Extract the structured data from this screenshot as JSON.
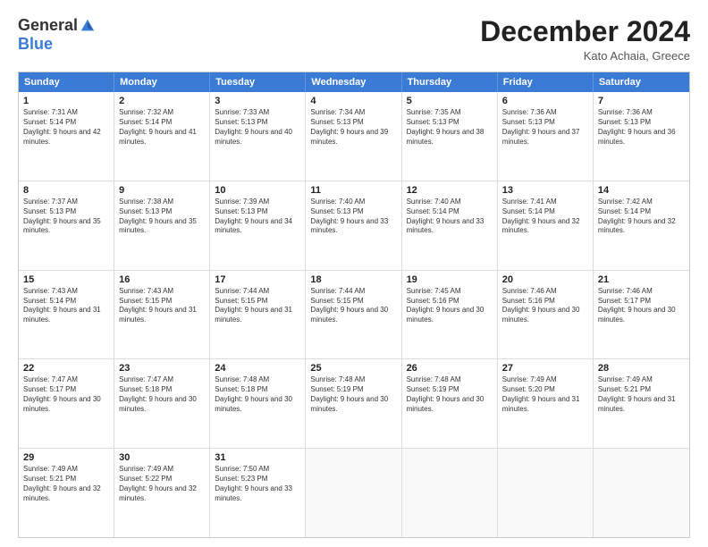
{
  "logo": {
    "general": "General",
    "blue": "Blue"
  },
  "header": {
    "month": "December 2024",
    "location": "Kato Achaia, Greece"
  },
  "weekdays": [
    "Sunday",
    "Monday",
    "Tuesday",
    "Wednesday",
    "Thursday",
    "Friday",
    "Saturday"
  ],
  "rows": [
    [
      {
        "day": "1",
        "sunrise": "Sunrise: 7:31 AM",
        "sunset": "Sunset: 5:14 PM",
        "daylight": "Daylight: 9 hours and 42 minutes."
      },
      {
        "day": "2",
        "sunrise": "Sunrise: 7:32 AM",
        "sunset": "Sunset: 5:14 PM",
        "daylight": "Daylight: 9 hours and 41 minutes."
      },
      {
        "day": "3",
        "sunrise": "Sunrise: 7:33 AM",
        "sunset": "Sunset: 5:13 PM",
        "daylight": "Daylight: 9 hours and 40 minutes."
      },
      {
        "day": "4",
        "sunrise": "Sunrise: 7:34 AM",
        "sunset": "Sunset: 5:13 PM",
        "daylight": "Daylight: 9 hours and 39 minutes."
      },
      {
        "day": "5",
        "sunrise": "Sunrise: 7:35 AM",
        "sunset": "Sunset: 5:13 PM",
        "daylight": "Daylight: 9 hours and 38 minutes."
      },
      {
        "day": "6",
        "sunrise": "Sunrise: 7:36 AM",
        "sunset": "Sunset: 5:13 PM",
        "daylight": "Daylight: 9 hours and 37 minutes."
      },
      {
        "day": "7",
        "sunrise": "Sunrise: 7:36 AM",
        "sunset": "Sunset: 5:13 PM",
        "daylight": "Daylight: 9 hours and 36 minutes."
      }
    ],
    [
      {
        "day": "8",
        "sunrise": "Sunrise: 7:37 AM",
        "sunset": "Sunset: 5:13 PM",
        "daylight": "Daylight: 9 hours and 35 minutes."
      },
      {
        "day": "9",
        "sunrise": "Sunrise: 7:38 AM",
        "sunset": "Sunset: 5:13 PM",
        "daylight": "Daylight: 9 hours and 35 minutes."
      },
      {
        "day": "10",
        "sunrise": "Sunrise: 7:39 AM",
        "sunset": "Sunset: 5:13 PM",
        "daylight": "Daylight: 9 hours and 34 minutes."
      },
      {
        "day": "11",
        "sunrise": "Sunrise: 7:40 AM",
        "sunset": "Sunset: 5:13 PM",
        "daylight": "Daylight: 9 hours and 33 minutes."
      },
      {
        "day": "12",
        "sunrise": "Sunrise: 7:40 AM",
        "sunset": "Sunset: 5:14 PM",
        "daylight": "Daylight: 9 hours and 33 minutes."
      },
      {
        "day": "13",
        "sunrise": "Sunrise: 7:41 AM",
        "sunset": "Sunset: 5:14 PM",
        "daylight": "Daylight: 9 hours and 32 minutes."
      },
      {
        "day": "14",
        "sunrise": "Sunrise: 7:42 AM",
        "sunset": "Sunset: 5:14 PM",
        "daylight": "Daylight: 9 hours and 32 minutes."
      }
    ],
    [
      {
        "day": "15",
        "sunrise": "Sunrise: 7:43 AM",
        "sunset": "Sunset: 5:14 PM",
        "daylight": "Daylight: 9 hours and 31 minutes."
      },
      {
        "day": "16",
        "sunrise": "Sunrise: 7:43 AM",
        "sunset": "Sunset: 5:15 PM",
        "daylight": "Daylight: 9 hours and 31 minutes."
      },
      {
        "day": "17",
        "sunrise": "Sunrise: 7:44 AM",
        "sunset": "Sunset: 5:15 PM",
        "daylight": "Daylight: 9 hours and 31 minutes."
      },
      {
        "day": "18",
        "sunrise": "Sunrise: 7:44 AM",
        "sunset": "Sunset: 5:15 PM",
        "daylight": "Daylight: 9 hours and 30 minutes."
      },
      {
        "day": "19",
        "sunrise": "Sunrise: 7:45 AM",
        "sunset": "Sunset: 5:16 PM",
        "daylight": "Daylight: 9 hours and 30 minutes."
      },
      {
        "day": "20",
        "sunrise": "Sunrise: 7:46 AM",
        "sunset": "Sunset: 5:16 PM",
        "daylight": "Daylight: 9 hours and 30 minutes."
      },
      {
        "day": "21",
        "sunrise": "Sunrise: 7:46 AM",
        "sunset": "Sunset: 5:17 PM",
        "daylight": "Daylight: 9 hours and 30 minutes."
      }
    ],
    [
      {
        "day": "22",
        "sunrise": "Sunrise: 7:47 AM",
        "sunset": "Sunset: 5:17 PM",
        "daylight": "Daylight: 9 hours and 30 minutes."
      },
      {
        "day": "23",
        "sunrise": "Sunrise: 7:47 AM",
        "sunset": "Sunset: 5:18 PM",
        "daylight": "Daylight: 9 hours and 30 minutes."
      },
      {
        "day": "24",
        "sunrise": "Sunrise: 7:48 AM",
        "sunset": "Sunset: 5:18 PM",
        "daylight": "Daylight: 9 hours and 30 minutes."
      },
      {
        "day": "25",
        "sunrise": "Sunrise: 7:48 AM",
        "sunset": "Sunset: 5:19 PM",
        "daylight": "Daylight: 9 hours and 30 minutes."
      },
      {
        "day": "26",
        "sunrise": "Sunrise: 7:48 AM",
        "sunset": "Sunset: 5:19 PM",
        "daylight": "Daylight: 9 hours and 30 minutes."
      },
      {
        "day": "27",
        "sunrise": "Sunrise: 7:49 AM",
        "sunset": "Sunset: 5:20 PM",
        "daylight": "Daylight: 9 hours and 31 minutes."
      },
      {
        "day": "28",
        "sunrise": "Sunrise: 7:49 AM",
        "sunset": "Sunset: 5:21 PM",
        "daylight": "Daylight: 9 hours and 31 minutes."
      }
    ],
    [
      {
        "day": "29",
        "sunrise": "Sunrise: 7:49 AM",
        "sunset": "Sunset: 5:21 PM",
        "daylight": "Daylight: 9 hours and 32 minutes."
      },
      {
        "day": "30",
        "sunrise": "Sunrise: 7:49 AM",
        "sunset": "Sunset: 5:22 PM",
        "daylight": "Daylight: 9 hours and 32 minutes."
      },
      {
        "day": "31",
        "sunrise": "Sunrise: 7:50 AM",
        "sunset": "Sunset: 5:23 PM",
        "daylight": "Daylight: 9 hours and 33 minutes."
      },
      {
        "day": "",
        "sunrise": "",
        "sunset": "",
        "daylight": ""
      },
      {
        "day": "",
        "sunrise": "",
        "sunset": "",
        "daylight": ""
      },
      {
        "day": "",
        "sunrise": "",
        "sunset": "",
        "daylight": ""
      },
      {
        "day": "",
        "sunrise": "",
        "sunset": "",
        "daylight": ""
      }
    ]
  ]
}
